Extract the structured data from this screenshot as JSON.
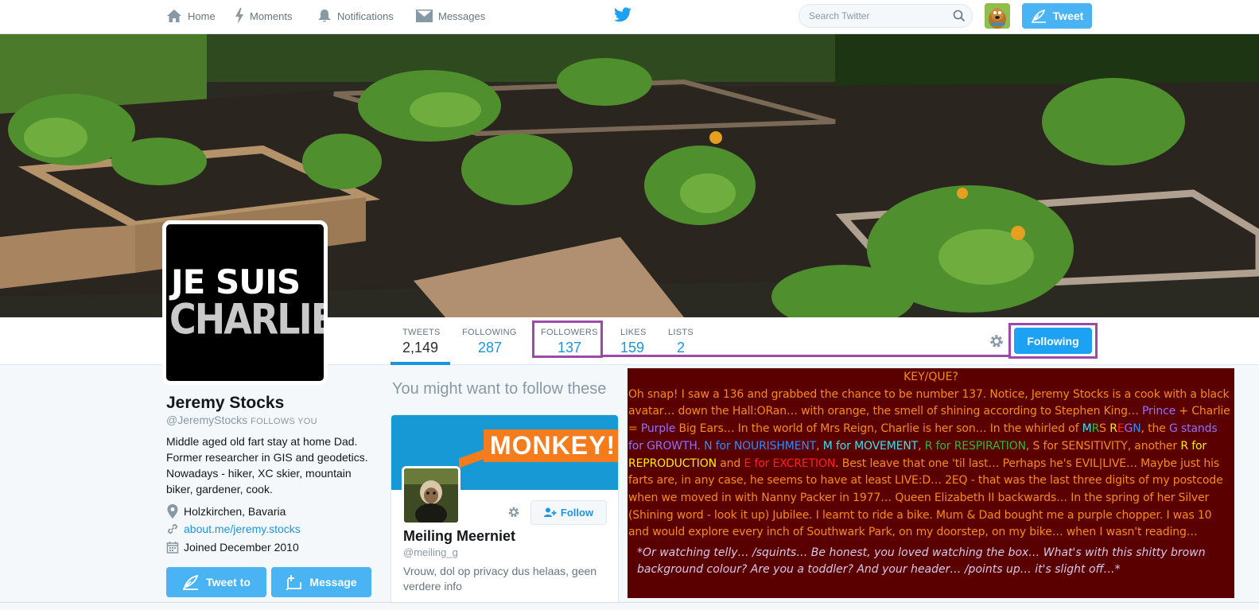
{
  "nav": {
    "home": "Home",
    "moments": "Moments",
    "notifications": "Notifications",
    "messages": "Messages",
    "search_placeholder": "Search Twitter",
    "tweet_button": "Tweet"
  },
  "profile": {
    "avatar_line1": "JE SUIS",
    "avatar_line2": "CHARLIE",
    "name": "Jeremy Stocks",
    "handle": "@JeremyStocks",
    "follows_you": "FOLLOWS YOU",
    "bio": "Middle aged old fart stay at home Dad. Former researcher in GIS and geodetics. Nowadays - hiker, XC skier, mountain biker, gardener, cook.",
    "location": "Holzkirchen, Bavaria",
    "website": "about.me/jeremy.stocks",
    "joined": "Joined December 2010",
    "tweet_to_button": "Tweet to",
    "message_button": "Message"
  },
  "stats": {
    "tweets_label": "TWEETS",
    "tweets": "2,149",
    "following_label": "FOLLOWING",
    "following": "287",
    "followers_label": "FOLLOWERS",
    "followers": "137",
    "likes_label": "LIKES",
    "likes": "159",
    "lists_label": "LISTS",
    "lists": "2",
    "following_button": "Following"
  },
  "suggestions": {
    "title": "You might want to follow these",
    "card": {
      "banner_text": "MONKEY!",
      "name": "Meiling Meerniet",
      "handle": "@meiling_g",
      "bio": "Vrouw, dol op privacy dus helaas, geen verdere info",
      "follow_button": "Follow"
    }
  },
  "key_panel": {
    "title": "KEY/QUE?",
    "t1": "Oh snap! I saw a 136 and grabbed the chance to be number 137. Notice, Jeremy Stocks is a cook with a black avatar… down the Hall:ORan… with orange, the smell of shining according to Stephen King… ",
    "prince": "Prince",
    "t2": " + Charlie = ",
    "purple": "Purple",
    "t3": " Big Ears… In the world of Mrs Reign, Charlie is her son… In the whirled of ",
    "m": "M",
    "r": "R",
    "s": "S",
    "space": " ",
    "r2": "R",
    "e": "E",
    "g": "G",
    "n": "N",
    "t4": ", the ",
    "g_growth": "G stands for GROWTH.",
    "n_nourish": "N for NOURISHMENT",
    "comma": ", ",
    "m_move": "M for MOVEMENT",
    "r_resp": "R for RESPIRATION",
    "s_sens": ", S for SENSITIVITY, another ",
    "r_repro": "R for REPRODUCTION",
    "and": " and ",
    "e_excr": "E for EXCRETION",
    "t5": ". Best leave that one 'til last… Perhaps he's EVIL|LIVE… Maybe just his farts are, in any case, he seems to have at least LIVE:D… 2EQ - that was the last three digits of my postcode when we moved in with Nanny Packer in 1977… Queen Elizabeth II backwards… In the spring of her Silver (Shining word - look it up) Jubilee. I learnt to ride a bike. Mum & Dad bought me a purple chopper. I was 10 and would explore every inch of Southwark Park, on my doorstep, on my bike… when I wasn't reading…",
    "footer": "*Or watching telly… /squints… Be honest, you loved watching the box… What's with this shitty brown background colour? Are you a toddler? And your header… /points up… it's slight off…*"
  },
  "colors": {
    "twitter_blue": "#1da1f2",
    "highlight_purple": "#9b4aa8",
    "panel_bg": "#5a0000",
    "panel_text": "#f88b1c"
  }
}
